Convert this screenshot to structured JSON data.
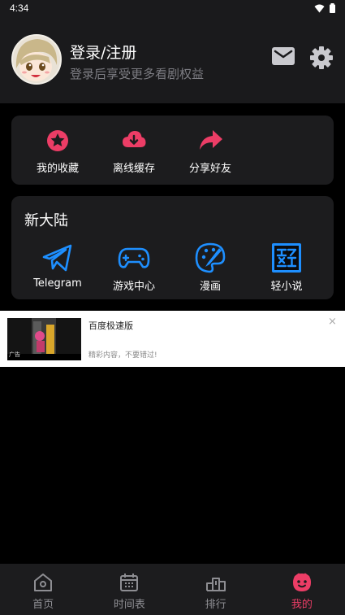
{
  "status_bar": {
    "time": "4:34"
  },
  "header": {
    "title": "登录/注册",
    "subtitle": "登录后享受更多看剧权益"
  },
  "quick_actions": [
    {
      "label": "我的收藏",
      "icon": "star-icon"
    },
    {
      "label": "离线缓存",
      "icon": "cloud-download-icon"
    },
    {
      "label": "分享好友",
      "icon": "share-arrow-icon"
    }
  ],
  "new_land": {
    "title": "新大陆",
    "apps": [
      {
        "label": "Telegram",
        "icon": "telegram-icon"
      },
      {
        "label": "游戏中心",
        "icon": "gamepad-icon"
      },
      {
        "label": "漫画",
        "icon": "palette-icon"
      },
      {
        "label": "轻小说",
        "icon": "light-novel-icon"
      }
    ]
  },
  "ad": {
    "title": "百度极速版",
    "description": "精彩内容，不要错过!",
    "close": "×",
    "mark": "广告"
  },
  "nav": {
    "items": [
      {
        "label": "首页",
        "icon": "home-icon"
      },
      {
        "label": "时间表",
        "icon": "calendar-icon"
      },
      {
        "label": "排行",
        "icon": "ranking-icon"
      },
      {
        "label": "我的",
        "icon": "profile-face-icon"
      }
    ],
    "active_index": 3
  },
  "colors": {
    "accent": "#ec3d66",
    "blue": "#1e8fff",
    "card": "#1c1c1e",
    "header": "#1a1a1c"
  }
}
